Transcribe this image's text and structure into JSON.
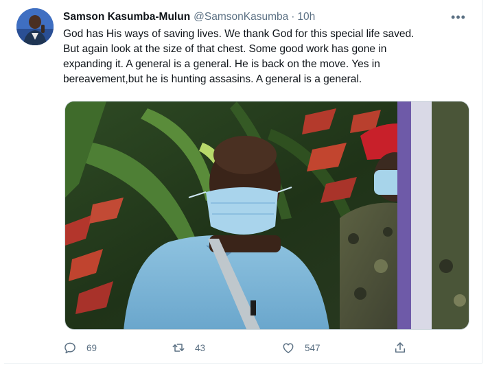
{
  "tweet": {
    "author_name": "Samson Kasumba-Mulun",
    "handle": "@SamsonKasumba",
    "separator": "·",
    "time": "10h",
    "more_label": "•••",
    "text": "God has His ways of saving lives. We thank God for this special life saved.\nBut again look at the size of that chest. Some good work has gone in\nexpanding it. A general is a general. He is back on the move. Yes in\nbereavement,but he is hunting assasins. A general is a general.",
    "photo": "photo: man in blue shirt wearing a surgical face mask, soldier in red beret in background"
  },
  "actions": {
    "reply_count": "69",
    "retweet_count": "43",
    "like_count": "547",
    "icons": [
      "reply-icon",
      "retweet-icon",
      "like-icon",
      "share-icon"
    ]
  },
  "colors": {
    "text": "#0f1419",
    "secondary": "#5b7083",
    "border": "#cfd9de"
  }
}
